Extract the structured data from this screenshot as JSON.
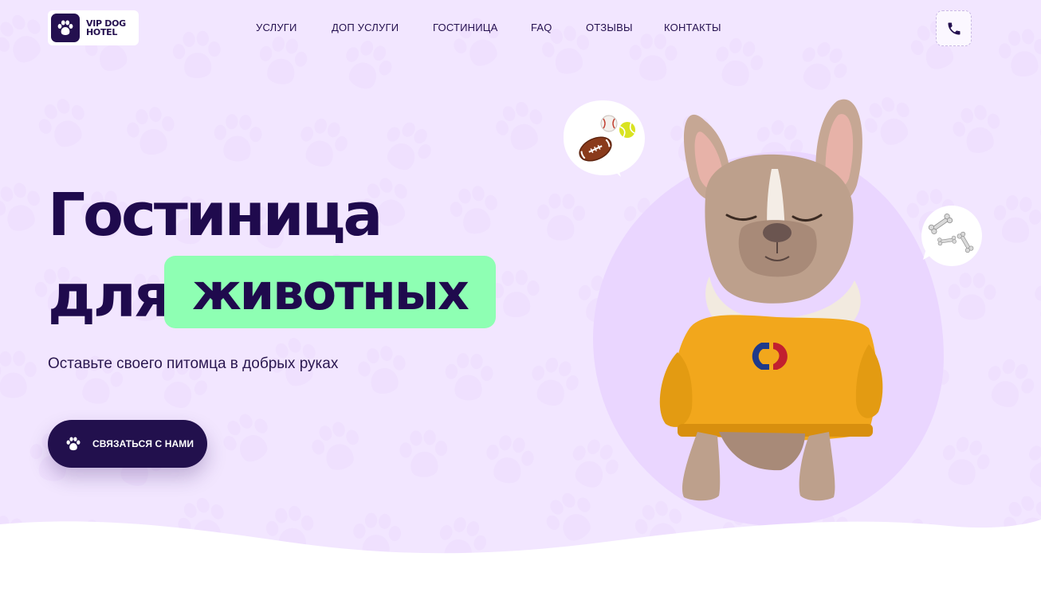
{
  "logo": {
    "line1": "VIP DOG",
    "line2": "HOTEL",
    "icon": "paw-icon"
  },
  "nav": {
    "items": [
      {
        "label": "УСЛУГИ"
      },
      {
        "label": "ДОП УСЛУГИ"
      },
      {
        "label": "ГОСТИНИЦА"
      },
      {
        "label": "FAQ"
      },
      {
        "label": "ОТЗЫВЫ"
      },
      {
        "label": "КОНТАКТЫ"
      }
    ],
    "phone_icon": "phone-icon"
  },
  "hero": {
    "title_line1": "Гостиница",
    "title_line2_word": "для",
    "title_highlight": "животных",
    "subtitle": "Оставьте своего питомца в добрых руках",
    "cta_label": "СВЯЗАТЬСЯ С НАМИ",
    "cta_icon": "paw-icon"
  },
  "colors": {
    "background": "#f2e6ff",
    "dark": "#22104d",
    "highlight": "#8effb3",
    "sweater": "#f2a71c"
  }
}
